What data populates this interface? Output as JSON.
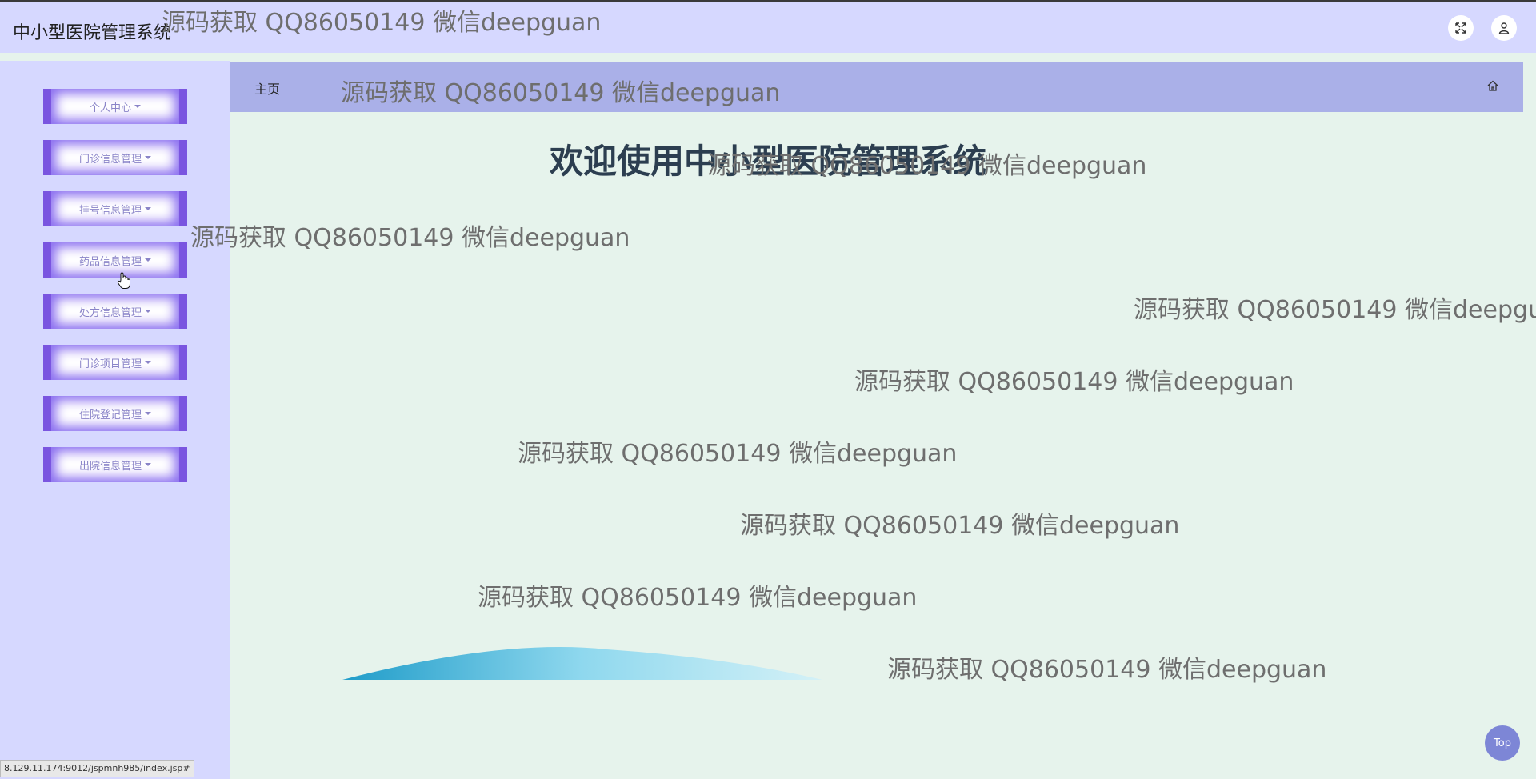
{
  "header": {
    "app_title": "中小型医院管理系统",
    "fullscreen_icon": "fullscreen-icon",
    "user_icon": "user-icon"
  },
  "sidebar": {
    "items": [
      {
        "label": "个人中心"
      },
      {
        "label": "门诊信息管理"
      },
      {
        "label": "挂号信息管理"
      },
      {
        "label": "药品信息管理"
      },
      {
        "label": "处方信息管理"
      },
      {
        "label": "门诊项目管理"
      },
      {
        "label": "住院登记管理"
      },
      {
        "label": "出院信息管理"
      }
    ]
  },
  "breadcrumb": {
    "home_label": "主页",
    "home_icon": "home-icon"
  },
  "main": {
    "welcome": "欢迎使用中小型医院管理系统"
  },
  "watermark": "源码获取 QQ86050149 微信deepguan",
  "top_button": "Top",
  "status_url": "8.129.11.174:9012/jspmnh985/index.jsp#",
  "colors": {
    "header_bg": "#d6d8ff",
    "sidebar_bg": "#d6d8ff",
    "breadcrumb_bg": "#aab0e8",
    "content_bg": "#e6f3ec",
    "menu_accent": "#7a55e0",
    "top_button": "#7d86d6"
  }
}
